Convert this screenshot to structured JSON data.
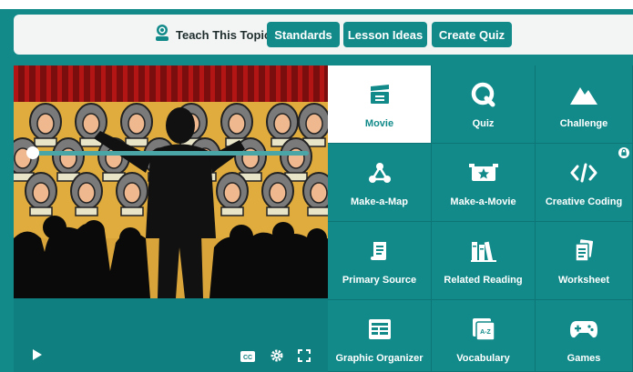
{
  "header": {
    "teach_label": "Teach This Topic",
    "buttons": [
      "Standards",
      "Lesson Ideas",
      "Create Quiz"
    ]
  },
  "player": {
    "progress": 0,
    "controls": {
      "play": "play-icon",
      "cc": "CC",
      "settings": "gear-icon",
      "fullscreen": "fullscreen-icon"
    }
  },
  "tiles": [
    {
      "label": "Movie",
      "icon": "clapperboard-icon",
      "active": true
    },
    {
      "label": "Quiz",
      "icon": "quiz-icon"
    },
    {
      "label": "Challenge",
      "icon": "mountain-icon"
    },
    {
      "label": "Make-a-Map",
      "icon": "concept-map-icon"
    },
    {
      "label": "Make-a-Movie",
      "icon": "movie-star-icon"
    },
    {
      "label": "Creative Coding",
      "icon": "code-icon",
      "locked": true
    },
    {
      "label": "Primary Source",
      "icon": "scroll-icon"
    },
    {
      "label": "Related Reading",
      "icon": "books-icon"
    },
    {
      "label": "Worksheet",
      "icon": "worksheet-icon"
    },
    {
      "label": "Graphic Organizer",
      "icon": "table-icon"
    },
    {
      "label": "Vocabulary",
      "icon": "vocab-cards-icon"
    },
    {
      "label": "Games",
      "icon": "gamepad-icon"
    }
  ],
  "colors": {
    "teal": "#128a8a",
    "white": "#ffffff"
  }
}
